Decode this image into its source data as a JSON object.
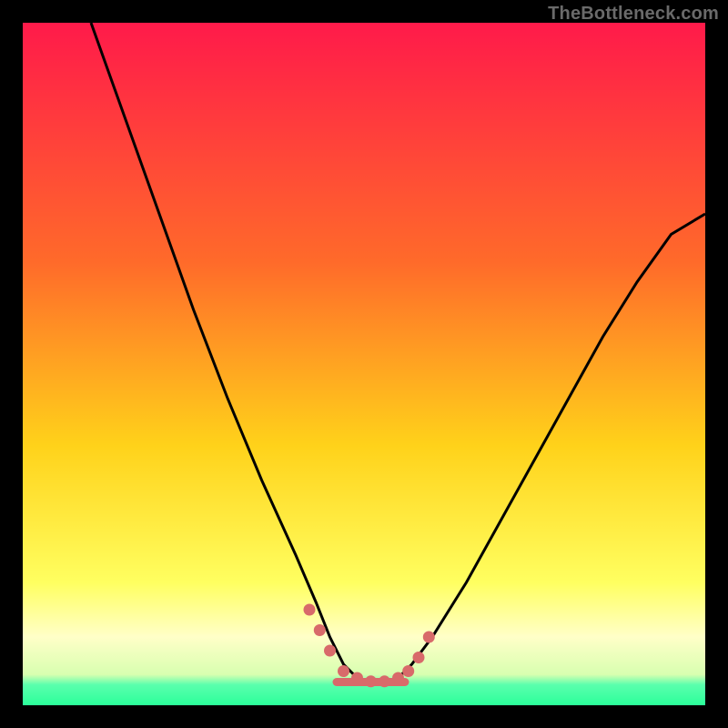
{
  "watermark": "TheBottleneck.com",
  "colors": {
    "bg": "#000000",
    "grad_top": "#ff1a4a",
    "grad_mid1": "#ff6a2a",
    "grad_mid2": "#ffd21a",
    "grad_mid3": "#ffff33",
    "grad_light": "#ffffb0",
    "grad_green": "#2bff9a",
    "curve": "#000000",
    "marker": "#d86a6a"
  },
  "chart_data": {
    "type": "line",
    "title": "",
    "xlabel": "",
    "ylabel": "",
    "xlim": [
      0,
      100
    ],
    "ylim": [
      0,
      100
    ],
    "series": [
      {
        "name": "bottleneck-curve",
        "x": [
          10,
          15,
          20,
          25,
          30,
          35,
          40,
          43,
          45,
          47,
          49,
          51,
          53,
          55,
          57,
          60,
          65,
          70,
          75,
          80,
          85,
          90,
          95,
          100
        ],
        "values": [
          100,
          86,
          72,
          58,
          45,
          33,
          22,
          15,
          10,
          6,
          4,
          3,
          3,
          4,
          6,
          10,
          18,
          27,
          36,
          45,
          54,
          62,
          69,
          72
        ]
      }
    ],
    "markers": {
      "name": "highlight-dots",
      "x": [
        42,
        43.5,
        45,
        47,
        49,
        51,
        53,
        55,
        56.5,
        58,
        59.5
      ],
      "values": [
        14,
        11,
        8,
        5,
        4,
        3.5,
        3.5,
        4,
        5,
        7,
        10
      ]
    },
    "gradient_stops": [
      {
        "pct": 0,
        "note": "red"
      },
      {
        "pct": 50,
        "note": "orange-yellow"
      },
      {
        "pct": 88,
        "note": "pale-yellow"
      },
      {
        "pct": 96,
        "note": "green"
      },
      {
        "pct": 100,
        "note": "green"
      }
    ]
  }
}
